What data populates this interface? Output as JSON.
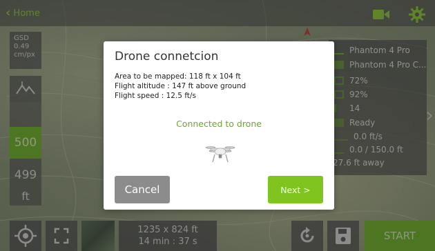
{
  "topbar": {
    "back_label": "Home"
  },
  "left": {
    "gsd_label": "GSD",
    "gsd_value": "0.49",
    "gsd_unit": "cm/px",
    "altitude_target": "500",
    "altitude_current": "499",
    "altitude_unit": "ft"
  },
  "right_panel": {
    "rows": [
      {
        "icon": "drone-model-icon",
        "text": "Phantom 4 Pro"
      },
      {
        "icon": "camera-model-icon",
        "text": "Phantom 4 Pro C..."
      },
      {
        "icon": "battery-icon",
        "text": "72%"
      },
      {
        "icon": "remote-battery-icon",
        "text": "92%"
      },
      {
        "icon": "satellite-icon",
        "text": "14"
      },
      {
        "icon": "status-icon",
        "text": "Ready"
      },
      {
        "icon": "speed-icon",
        "text": "0.0 ft/s"
      },
      {
        "icon": "altitude-icon",
        "text": "0.0 / 150.0 ft"
      },
      {
        "icon": "distance-icon",
        "text": "27.6 ft away"
      }
    ]
  },
  "bottom": {
    "area_dims": "1235 x 824 ft",
    "flight_time": "14 min : 37 s",
    "start_label": "START"
  },
  "modal": {
    "title": "Drone connetcion",
    "area": "Area to be mapped: 118 ft x 104 ft",
    "altitude": "Flight altitude : 147 ft above ground",
    "speed": "Flight speed : 12.5 ft/s",
    "status": "Connected to drone",
    "cancel_label": "Cancel",
    "next_label": "Next >"
  },
  "colors": {
    "accent_green": "#6cb61f",
    "status_green": "#6aa92a",
    "back_green": "#8ed02a"
  }
}
